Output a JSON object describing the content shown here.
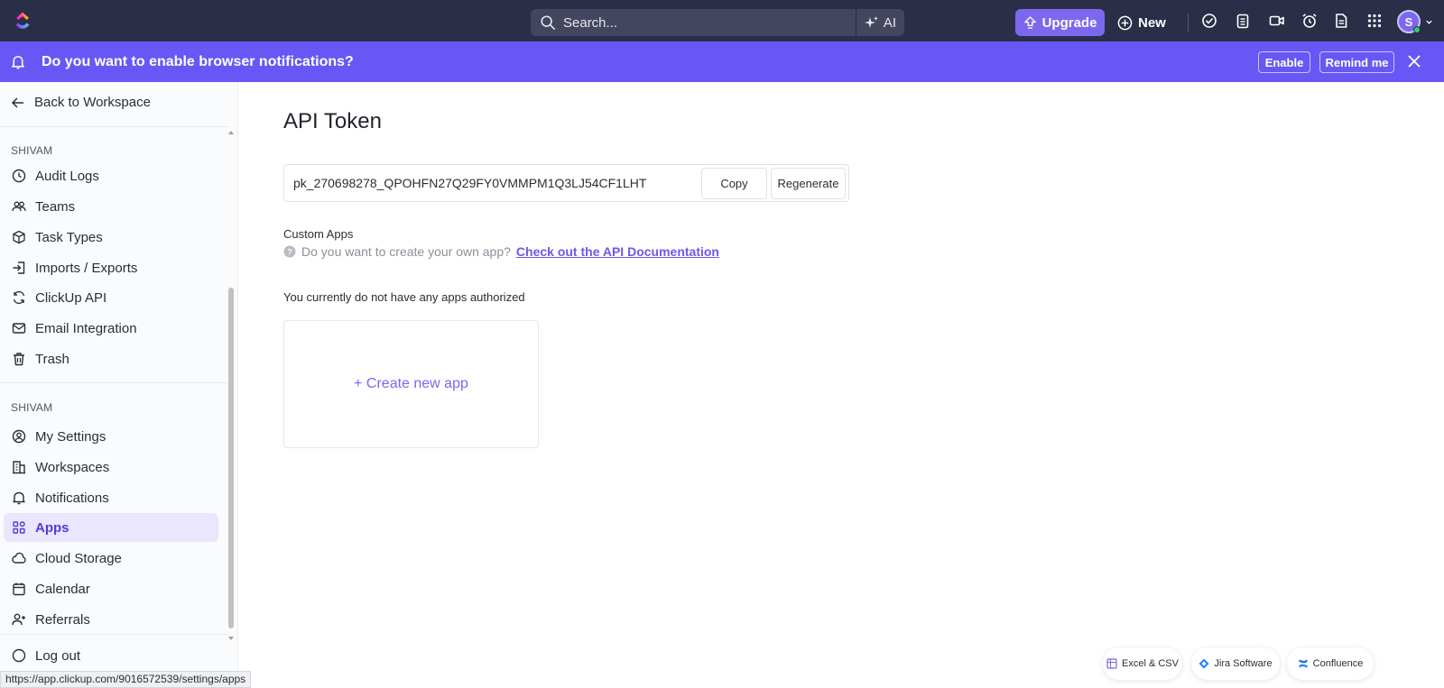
{
  "topbar": {
    "search_placeholder": "Search...",
    "ai_label": "AI",
    "upgrade_label": "Upgrade",
    "new_label": "New",
    "avatar_initial": "S",
    "icons": [
      "check-circle-icon",
      "clipboard-icon",
      "video-icon",
      "alarm-clock-icon",
      "document-icon",
      "apps-grid-icon"
    ]
  },
  "notification": {
    "text": "Do you want to enable browser notifications?",
    "enable_label": "Enable",
    "remind_label": "Remind me"
  },
  "sidebar": {
    "back_label": "Back to Workspace",
    "section1": "SHIVAM",
    "items1": [
      {
        "label": "Audit Logs",
        "icon": "audit-log-icon"
      },
      {
        "label": "Teams",
        "icon": "teams-icon"
      },
      {
        "label": "Task Types",
        "icon": "cube-icon"
      },
      {
        "label": "Imports / Exports",
        "icon": "import-icon"
      },
      {
        "label": "ClickUp API",
        "icon": "sync-icon"
      },
      {
        "label": "Email Integration",
        "icon": "mail-icon"
      },
      {
        "label": "Trash",
        "icon": "trash-icon"
      }
    ],
    "section2": "SHIVAM",
    "items2": [
      {
        "label": "My Settings",
        "icon": "user-circle-icon"
      },
      {
        "label": "Workspaces",
        "icon": "building-icon"
      },
      {
        "label": "Notifications",
        "icon": "bell-icon"
      },
      {
        "label": "Apps",
        "icon": "apps-icon",
        "active": true
      },
      {
        "label": "Cloud Storage",
        "icon": "cloud-icon"
      },
      {
        "label": "Calendar",
        "icon": "calendar-icon"
      },
      {
        "label": "Referrals",
        "icon": "user-plus-icon"
      }
    ],
    "logout_label": "Log out"
  },
  "main": {
    "title": "API Token",
    "token_value": "pk_270698278_QPOHFN27Q29FY0VMMPM1Q3LJ54CF1LHT",
    "copy_label": "Copy",
    "regenerate_label": "Regenerate",
    "custom_apps_label": "Custom Apps",
    "help_text": "Do you want to create your own app?",
    "doc_link": "Check out the API Documentation",
    "no_apps_text": "You currently do not have any apps authorized",
    "create_app_label": "+ Create new app"
  },
  "integrations": {
    "excel": "Excel & CSV",
    "jira": "Jira Software",
    "confluence": "Confluence"
  },
  "statusbar": {
    "url": "https://app.clickup.com/9016572539/settings/apps"
  },
  "colors": {
    "topbar": "#2b2e47",
    "accent": "#7b68ee",
    "notification_bar": "#6957f5",
    "active_item_bg": "#e9e6fd"
  }
}
